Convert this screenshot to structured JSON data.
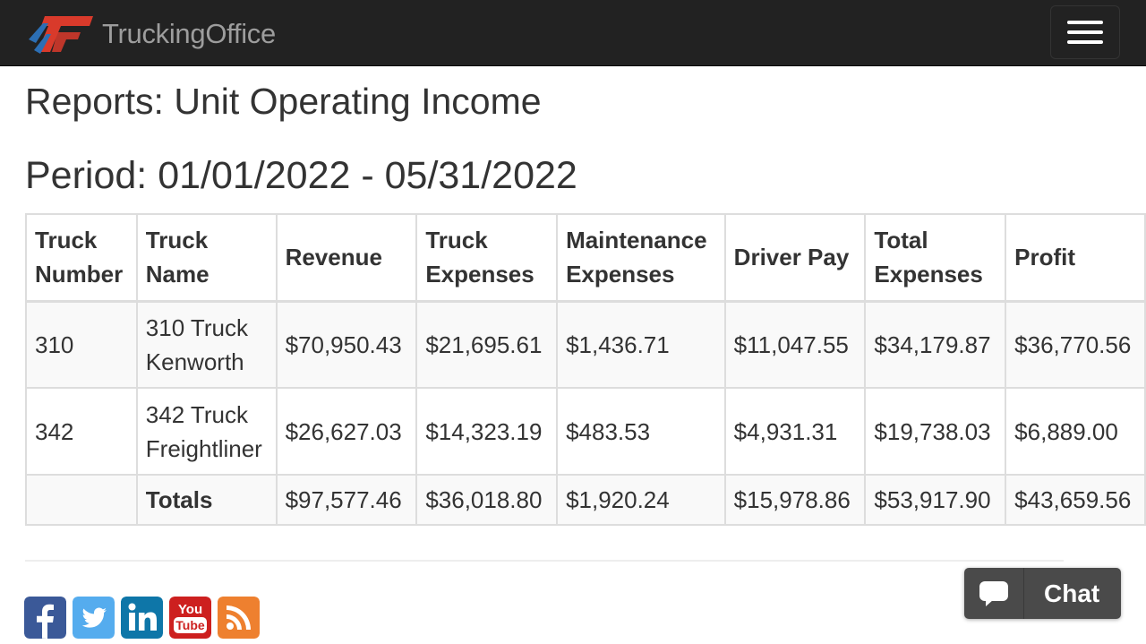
{
  "app": {
    "brand_name": "TruckingOffice"
  },
  "page": {
    "title": "Reports: Unit Operating Income",
    "period": "Period: 01/01/2022 - 05/31/2022"
  },
  "table": {
    "headers": {
      "truck_number": [
        "Truck",
        "Number"
      ],
      "truck_name": [
        "Truck",
        "Name"
      ],
      "revenue": "Revenue",
      "truck_expenses": [
        "Truck",
        "Expenses"
      ],
      "maintenance_expenses": [
        "Maintenance",
        "Expenses"
      ],
      "driver_pay": "Driver Pay",
      "total_expenses": [
        "Total",
        "Expenses"
      ],
      "profit": "Profit"
    },
    "rows": [
      {
        "truck_number": "310",
        "truck_name": [
          "310 Truck",
          "Kenworth"
        ],
        "revenue": "$70,950.43",
        "truck_expenses": "$21,695.61",
        "maintenance_expenses": "$1,436.71",
        "driver_pay": "$11,047.55",
        "total_expenses": "$34,179.87",
        "profit": "$36,770.56"
      },
      {
        "truck_number": "342",
        "truck_name": [
          "342 Truck",
          "Freightliner"
        ],
        "revenue": "$26,627.03",
        "truck_expenses": "$14,323.19",
        "maintenance_expenses": "$483.53",
        "driver_pay": "$4,931.31",
        "total_expenses": "$19,738.03",
        "profit": "$6,889.00"
      }
    ],
    "totals": {
      "truck_number": "",
      "label": "Totals",
      "revenue": "$97,577.46",
      "truck_expenses": "$36,018.80",
      "maintenance_expenses": "$1,920.24",
      "driver_pay": "$15,978.86",
      "total_expenses": "$53,917.90",
      "profit": "$43,659.56"
    }
  },
  "footer": {
    "social_icons": [
      {
        "name": "facebook-icon",
        "color": "#3b5998"
      },
      {
        "name": "twitter-icon",
        "color": "#55acee"
      },
      {
        "name": "linkedin-icon",
        "color": "#0e76a8"
      },
      {
        "name": "youtube-icon",
        "color": "#cd201f",
        "text_top": "You",
        "text_bottom": "Tube"
      },
      {
        "name": "rss-icon",
        "color": "#ee802f"
      }
    ]
  },
  "chat": {
    "label": "Chat"
  },
  "colors": {
    "navbar": "#222222",
    "brand_red": "#d93a2b",
    "brand_blue": "#2c6fb5",
    "chat_bg": "#4a4a4a"
  }
}
